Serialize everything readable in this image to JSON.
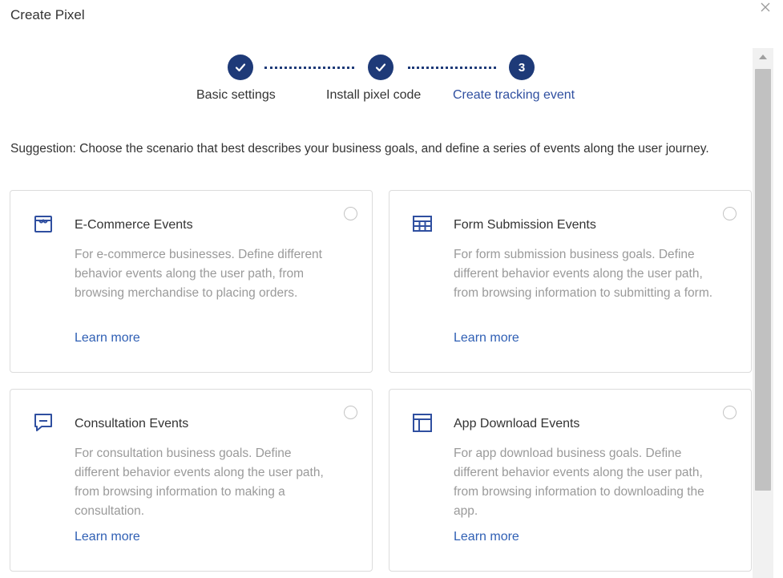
{
  "dialog": {
    "title": "Create Pixel",
    "close_icon": "close-icon"
  },
  "steps": [
    {
      "label": "Basic settings",
      "status": "done",
      "icon": "checkmark-icon"
    },
    {
      "label": "Install pixel code",
      "status": "done",
      "icon": "checkmark-icon"
    },
    {
      "label": "Create tracking event",
      "status": "current",
      "number": "3"
    }
  ],
  "suggestion": "Suggestion: Choose the scenario that best describes your business goals, and define a series of events along the user journey.",
  "cards": [
    {
      "title": "E-Commerce Events",
      "icon": "storefront-icon",
      "description": "For e-commerce businesses. Define different behavior events along the user path, from browsing merchandise to placing orders.",
      "link": "Learn more"
    },
    {
      "title": "Form Submission Events",
      "icon": "table-form-icon",
      "description": "For form submission business goals. Define different behavior events along the user path, from browsing information to submitting a form.",
      "link": "Learn more"
    },
    {
      "title": "Consultation Events",
      "icon": "chat-bubble-icon",
      "description": "For consultation business goals. Define different behavior events along the user path, from browsing information to making a consultation.",
      "link": "Learn more"
    },
    {
      "title": "App Download Events",
      "icon": "app-layout-icon",
      "description": "For app download business goals. Define different behavior events along the user path, from browsing information to downloading the app.",
      "link": "Learn more"
    }
  ],
  "colors": {
    "accent": "#1e3a78",
    "link": "#2f5fb4",
    "muted_text": "#9a9a9a",
    "border": "#dcdcdc"
  }
}
